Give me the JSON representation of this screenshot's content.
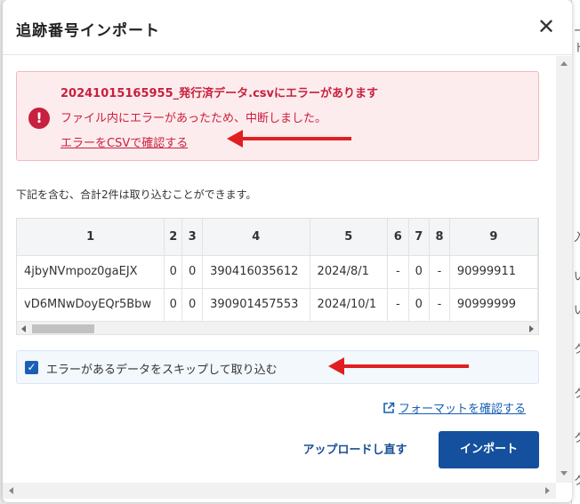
{
  "modal": {
    "title": "追跡番号インポート",
    "close_label": "✕"
  },
  "error": {
    "title": "20241015165955_発行済データ.csvにエラーがあります",
    "message": "ファイル内にエラーがあったため、中断しました。",
    "link_label": "エラーをCSVで確認する",
    "icon": "exclamation-circle-icon",
    "color": "#c8203f"
  },
  "summary": "下記を含む、合計2件は取り込むことができます。",
  "table": {
    "headers": [
      "1",
      "2",
      "3",
      "4",
      "5",
      "6",
      "7",
      "8",
      "9"
    ],
    "rows": [
      [
        "4jbyNVmpoz0gaEJX",
        "0",
        "0",
        "390416035612",
        "2024/8/1",
        "-",
        "0",
        "-",
        "90999911"
      ],
      [
        "vD6MNwDoyEQr5Bbw",
        "0",
        "0",
        "390901457553",
        "2024/10/1",
        "-",
        "0",
        "-",
        "90999999"
      ]
    ]
  },
  "skip": {
    "checked": true,
    "label": "エラーがあるデータをスキップして取り込む"
  },
  "format_link": {
    "label": "フォーマットを確認する",
    "icon": "external-link-icon"
  },
  "buttons": {
    "reupload": "アップロードし直す",
    "import": "インポート"
  },
  "background_right": [
    "ート",
    "入",
    "い",
    "い",
    "ク",
    "ク",
    "ク",
    "ク"
  ],
  "colors": {
    "primary": "#14509e",
    "link": "#1a5fb4",
    "annotation_arrow": "#e11f22"
  }
}
